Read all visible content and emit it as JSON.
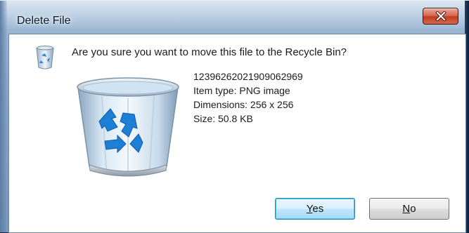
{
  "window": {
    "title": "Delete File",
    "close_icon": "close-icon"
  },
  "dialog": {
    "question": "Are you sure you want to move this file to the Recycle Bin?",
    "icons": {
      "small": "recycle-bin-icon",
      "large": "recycle-bin-icon"
    },
    "file": {
      "name": "12396262021909062969",
      "item_type": "Item type: PNG image",
      "dimensions": "Dimensions: 256 x 256",
      "size": "Size: 50.8 KB"
    },
    "buttons": {
      "yes_label": "Yes",
      "no_label": "No"
    }
  },
  "colors": {
    "close_button": "#c9432a",
    "focus_button": "#bee6fd",
    "recycle_arrows": "#1e7fd6"
  }
}
